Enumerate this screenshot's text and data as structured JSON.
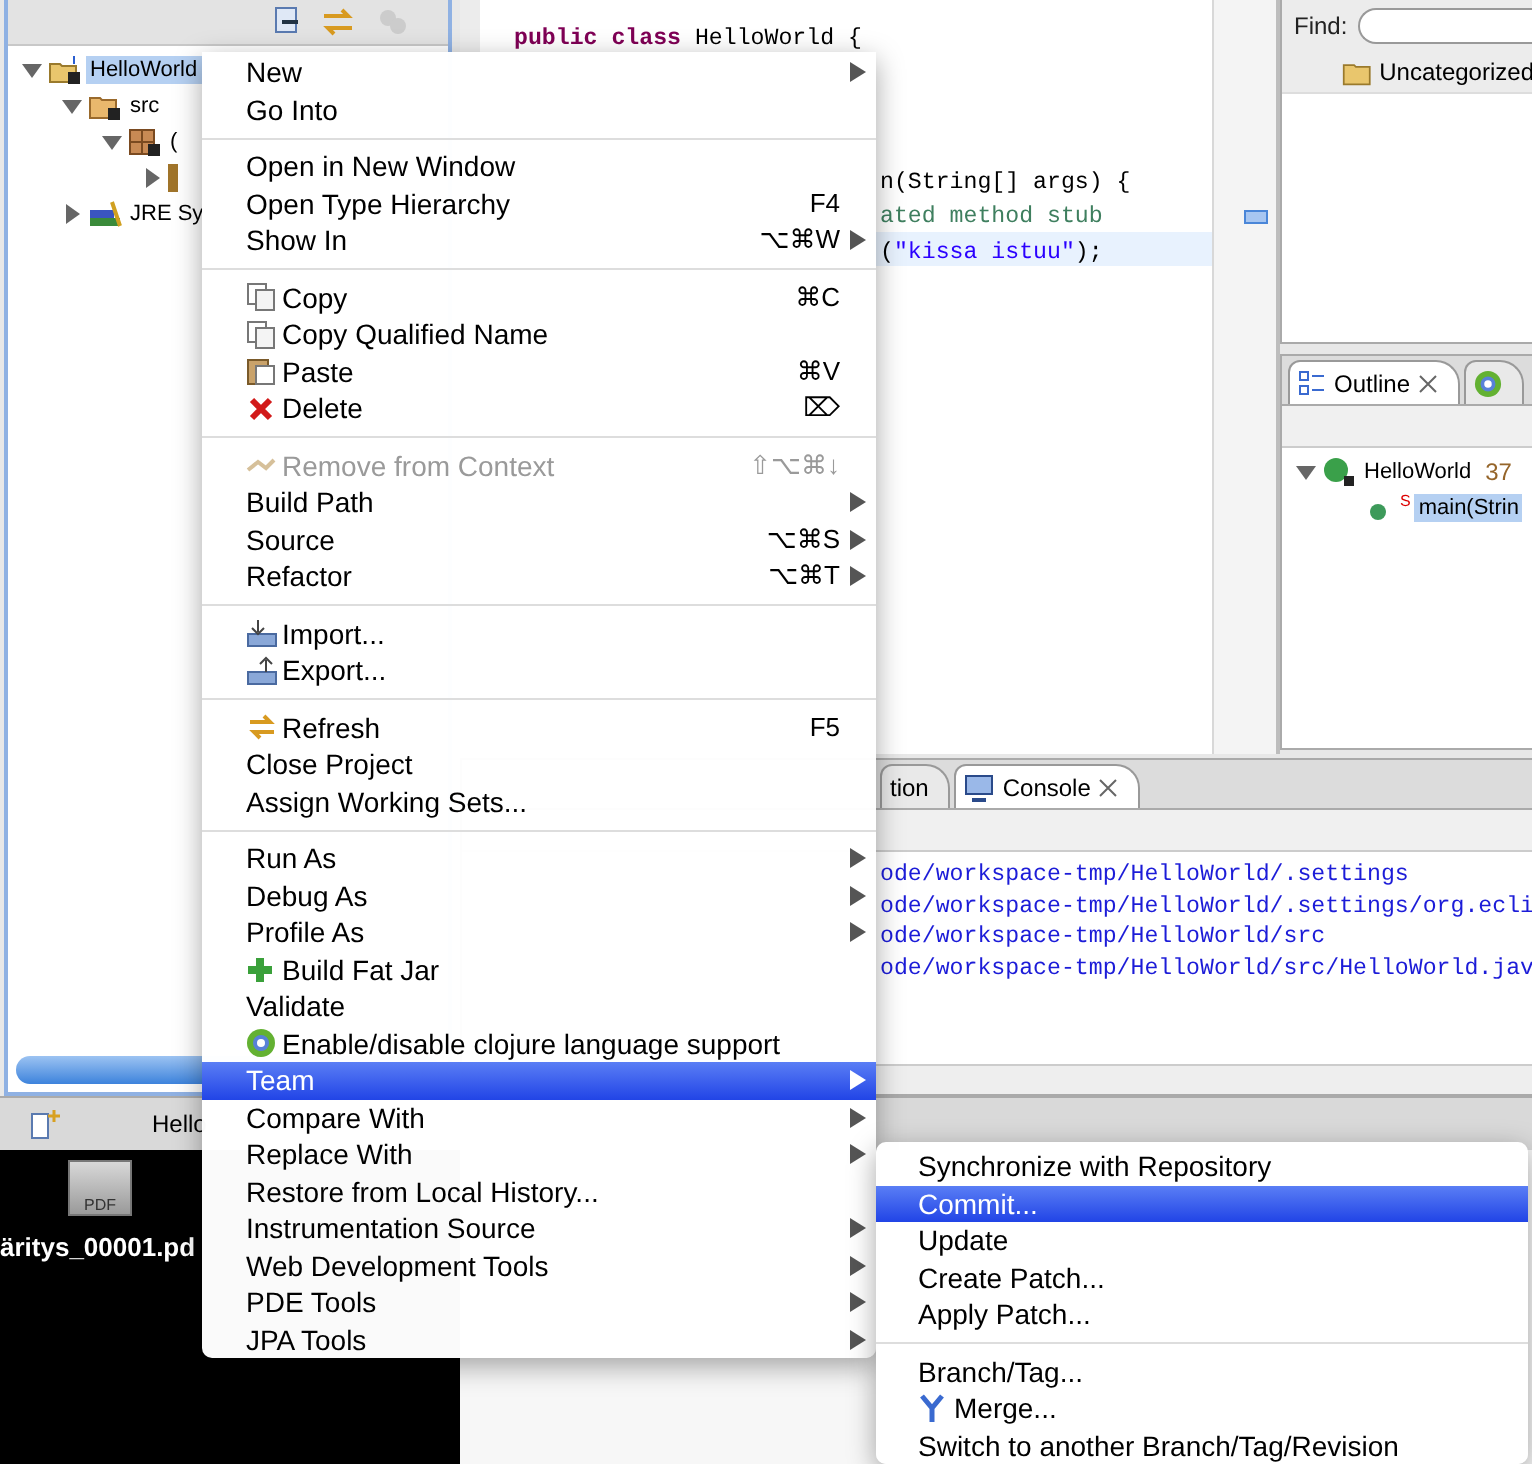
{
  "explorer": {
    "tree": [
      {
        "label": "HelloWorld",
        "kind": "project",
        "selected": true,
        "expanded": true,
        "children": [
          {
            "label": "src",
            "kind": "source-folder",
            "selected": false,
            "expanded": true,
            "children": [
              {
                "label": "(",
                "kind": "package",
                "selected": false,
                "expanded": true,
                "children": [
                  {
                    "kind": "file",
                    "expanded": false
                  }
                ]
              }
            ]
          },
          {
            "label": "JRE Sy",
            "kind": "library",
            "selected": false,
            "expanded": false
          }
        ]
      }
    ]
  },
  "editor": {
    "blocks": [
      {
        "lines": [
          {
            "current": false,
            "clipped": false,
            "segments": [
              {
                "kind": "keyword",
                "text": "public class"
              },
              {
                "kind": "plain",
                "text": " HelloWorld {"
              }
            ]
          }
        ]
      },
      {
        "lines": [
          {
            "current": false,
            "clipped": true,
            "segments": [
              {
                "kind": "plain",
                "text": "n(String[] args) {"
              }
            ]
          },
          {
            "current": false,
            "clipped": true,
            "segments": [
              {
                "kind": "comment",
                "text": "ated method stub"
              }
            ]
          },
          {
            "current": true,
            "clipped": true,
            "segments": [
              {
                "kind": "plain",
                "text": "("
              },
              {
                "kind": "string",
                "text": "\"kissa istuu\""
              },
              {
                "kind": "plain",
                "text": ");"
              }
            ]
          }
        ]
      }
    ]
  },
  "search": {
    "label": "Find:"
  },
  "categories": [
    {
      "label": "Uncategorized"
    }
  ],
  "outline": {
    "tabs": [
      {
        "label": "Outline",
        "selected": true,
        "closable": true
      },
      {
        "selected": false,
        "closable": false
      }
    ],
    "tree": [
      {
        "label": "HelloWorld",
        "count": "37",
        "kind": "class",
        "selected": false,
        "expanded": true,
        "children": [
          {
            "label": "main(Strin",
            "marker": "S",
            "kind": "method",
            "selected": true
          }
        ]
      }
    ]
  },
  "console": {
    "tabs": [
      {
        "label": "tion",
        "selected": false,
        "closable": false
      },
      {
        "label": "Console",
        "selected": true,
        "closable": true
      }
    ],
    "lines": [
      "ode/workspace-tmp/HelloWorld/.settings",
      "ode/workspace-tmp/HelloWorld/.settings/org.ecli",
      "ode/workspace-tmp/HelloWorld/src",
      "ode/workspace-tmp/HelloWorld/src/HelloWorld.jav"
    ]
  },
  "status_bar": {
    "label": "Hello"
  },
  "desktop": {
    "files": [
      {
        "name": "äritys_00001.pd",
        "badge": "PDF"
      }
    ]
  },
  "menu": {
    "items": [
      {
        "kind": "item",
        "label": "New",
        "submenu": true,
        "selected": false,
        "disabled": false
      },
      {
        "kind": "item",
        "label": "Go Into",
        "submenu": false,
        "selected": false,
        "disabled": false
      },
      {
        "kind": "separator"
      },
      {
        "kind": "item",
        "label": "Open in New Window",
        "submenu": false,
        "selected": false,
        "disabled": false
      },
      {
        "kind": "item",
        "label": "Open Type Hierarchy",
        "shortcut": "F4",
        "submenu": false,
        "selected": false,
        "disabled": false
      },
      {
        "kind": "item",
        "label": "Show In",
        "shortcut": "⌥⌘W",
        "submenu": true,
        "selected": false,
        "disabled": false
      },
      {
        "kind": "separator"
      },
      {
        "kind": "item",
        "label": "Copy",
        "shortcut": "⌘C",
        "submenu": false,
        "selected": false,
        "disabled": false
      },
      {
        "kind": "item",
        "label": "Copy Qualified Name",
        "submenu": false,
        "selected": false,
        "disabled": false
      },
      {
        "kind": "item",
        "label": "Paste",
        "shortcut": "⌘V",
        "submenu": false,
        "selected": false,
        "disabled": false
      },
      {
        "kind": "item",
        "label": "Delete",
        "shortcut": "⌦",
        "submenu": false,
        "selected": false,
        "disabled": false
      },
      {
        "kind": "separator"
      },
      {
        "kind": "item",
        "label": "Remove from Context",
        "shortcut": "⇧⌥⌘↓",
        "submenu": false,
        "selected": false,
        "disabled": true
      },
      {
        "kind": "item",
        "label": "Build Path",
        "submenu": true,
        "selected": false,
        "disabled": false
      },
      {
        "kind": "item",
        "label": "Source",
        "shortcut": "⌥⌘S",
        "submenu": true,
        "selected": false,
        "disabled": false
      },
      {
        "kind": "item",
        "label": "Refactor",
        "shortcut": "⌥⌘T",
        "submenu": true,
        "selected": false,
        "disabled": false
      },
      {
        "kind": "separator"
      },
      {
        "kind": "item",
        "label": "Import...",
        "submenu": false,
        "selected": false,
        "disabled": false
      },
      {
        "kind": "item",
        "label": "Export...",
        "submenu": false,
        "selected": false,
        "disabled": false
      },
      {
        "kind": "separator"
      },
      {
        "kind": "item",
        "label": "Refresh",
        "shortcut": "F5",
        "submenu": false,
        "selected": false,
        "disabled": false
      },
      {
        "kind": "item",
        "label": "Close Project",
        "submenu": false,
        "selected": false,
        "disabled": false
      },
      {
        "kind": "item",
        "label": "Assign Working Sets...",
        "submenu": false,
        "selected": false,
        "disabled": false
      },
      {
        "kind": "separator"
      },
      {
        "kind": "item",
        "label": "Run As",
        "submenu": true,
        "selected": false,
        "disabled": false
      },
      {
        "kind": "item",
        "label": "Debug As",
        "submenu": true,
        "selected": false,
        "disabled": false
      },
      {
        "kind": "item",
        "label": "Profile As",
        "submenu": true,
        "selected": false,
        "disabled": false
      },
      {
        "kind": "item",
        "label": "Build Fat Jar",
        "submenu": false,
        "selected": false,
        "disabled": false
      },
      {
        "kind": "item",
        "label": "Validate",
        "submenu": false,
        "selected": false,
        "disabled": false
      },
      {
        "kind": "item",
        "label": "Enable/disable clojure language support",
        "submenu": false,
        "selected": false,
        "disabled": false
      },
      {
        "kind": "item",
        "label": "Team",
        "submenu": true,
        "selected": true,
        "disabled": false
      },
      {
        "kind": "item",
        "label": "Compare With",
        "submenu": true,
        "selected": false,
        "disabled": false
      },
      {
        "kind": "item",
        "label": "Replace With",
        "submenu": true,
        "selected": false,
        "disabled": false
      },
      {
        "kind": "item",
        "label": "Restore from Local History...",
        "submenu": false,
        "selected": false,
        "disabled": false
      },
      {
        "kind": "item",
        "label": "Instrumentation Source",
        "submenu": true,
        "selected": false,
        "disabled": false
      },
      {
        "kind": "item",
        "label": "Web Development Tools",
        "submenu": true,
        "selected": false,
        "disabled": false
      },
      {
        "kind": "item",
        "label": "PDE Tools",
        "submenu": true,
        "selected": false,
        "disabled": false
      },
      {
        "kind": "item",
        "label": "JPA Tools",
        "submenu": true,
        "selected": false,
        "disabled": false
      }
    ]
  },
  "submenu": {
    "items": [
      {
        "kind": "item",
        "label": "Synchronize with Repository",
        "selected": false
      },
      {
        "kind": "item",
        "label": "Commit...",
        "selected": true
      },
      {
        "kind": "item",
        "label": "Update",
        "selected": false
      },
      {
        "kind": "item",
        "label": "Create Patch...",
        "selected": false
      },
      {
        "kind": "item",
        "label": "Apply Patch...",
        "selected": false
      },
      {
        "kind": "separator"
      },
      {
        "kind": "item",
        "label": "Branch/Tag...",
        "selected": false
      },
      {
        "kind": "item",
        "label": "Merge...",
        "selected": false
      },
      {
        "kind": "item",
        "label": "Switch to another Branch/Tag/Revision",
        "selected": false
      }
    ]
  }
}
